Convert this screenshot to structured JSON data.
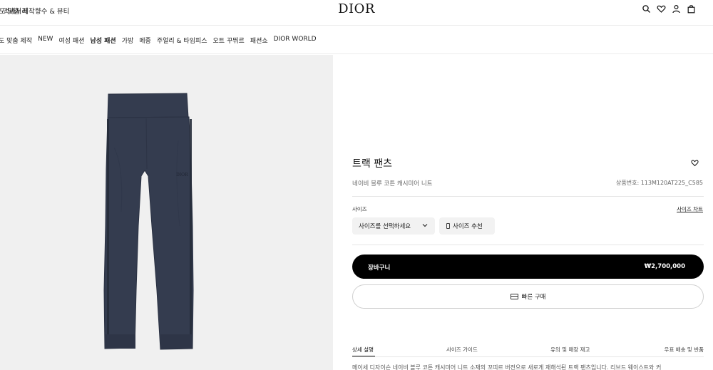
{
  "header": {
    "links": [
      "도 맞춤 제작",
      "액세서리",
      "향수 & 뷰티"
    ],
    "logo": "DIOR",
    "icons": [
      "search-icon",
      "heart-icon",
      "user-icon",
      "bag-icon"
    ]
  },
  "nav": {
    "items": [
      "도 맞춤 제작",
      "NEW",
      "여성 패션",
      "남성 패션",
      "가방",
      "메종",
      "주얼리 & 타임피스",
      "오트 꾸뛰르",
      "패션쇼",
      "DIOR WORLD"
    ],
    "active": "남성 패션"
  },
  "product": {
    "title": "트랙 팬츠",
    "subtitle": "네이비 블루 코튼 캐시미어 니트",
    "reference": "상품번호: 113M120AT225_C585",
    "garment_color": "#343c4f",
    "photo_bg": "#f0f0f0",
    "logo_text": "DIOR"
  },
  "size": {
    "label": "사이즈",
    "chart_link": "사이즈 차트",
    "select_placeholder": "사이즈를 선택하세요",
    "recommend_label": "사이즈 추천"
  },
  "buttons": {
    "cart_label": "장바구니",
    "cart_price": "₩2,700,000",
    "quick_buy_label": "빠른 구매"
  },
  "tabs": {
    "items": [
      "상세 설명",
      "사이즈 가이드",
      "유의 및 매장 재고",
      "우표 배송 및 반품"
    ],
    "active": "상세 설명"
  },
  "description": "메이세 디자이슨 네이비 블루 코튼 캐시미어 니트 소재의 꼬띠르 버전으로 새로게 재해석된 트랙 팬츠입니다. 리브드 웨이스트와 커"
}
